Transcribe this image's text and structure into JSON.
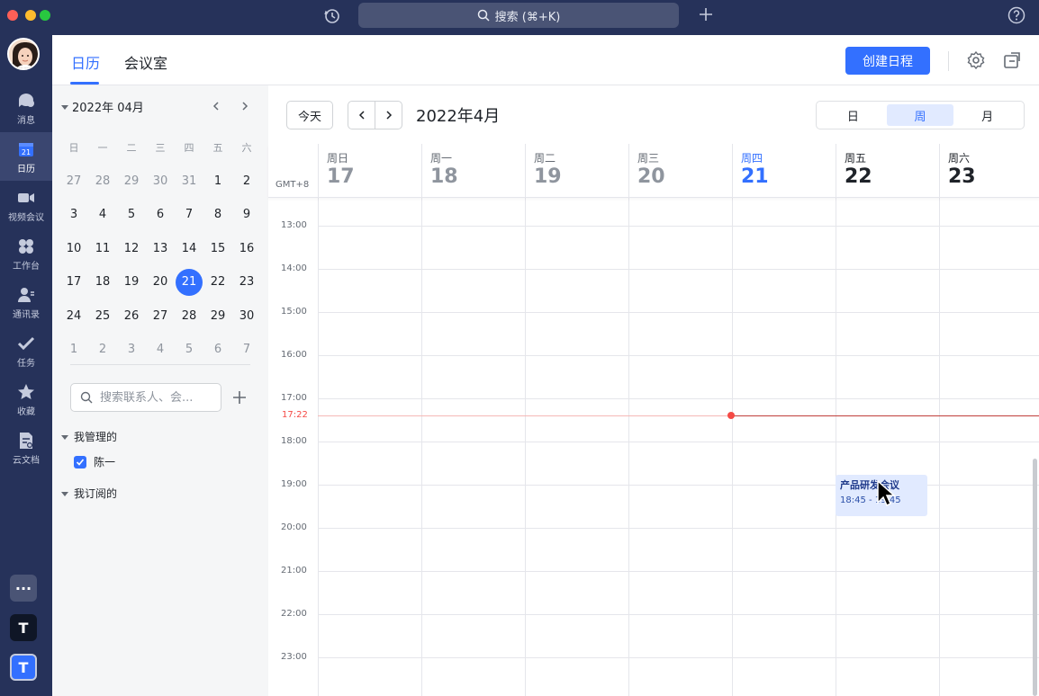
{
  "titlebar": {
    "search_label": "搜索 (⌘+K)"
  },
  "rail": {
    "items": [
      {
        "label": "消息",
        "icon": "message-icon"
      },
      {
        "label": "日历",
        "icon": "calendar-icon",
        "badge": "21"
      },
      {
        "label": "视频会议",
        "icon": "video-icon"
      },
      {
        "label": "工作台",
        "icon": "workspace-icon"
      },
      {
        "label": "通讯录",
        "icon": "contacts-icon"
      },
      {
        "label": "任务",
        "icon": "task-icon"
      },
      {
        "label": "收藏",
        "icon": "star-icon"
      },
      {
        "label": "云文档",
        "icon": "doc-icon"
      }
    ],
    "bottom": {
      "more": "···",
      "t1": "T",
      "t2": "T"
    }
  },
  "topbar": {
    "tab_calendar": "日历",
    "tab_room": "会议室",
    "create_label": "创建日程"
  },
  "mini": {
    "month_label": "2022年 04月",
    "weekdays": [
      "日",
      "一",
      "二",
      "三",
      "四",
      "五",
      "六"
    ],
    "weeks": [
      [
        "27",
        "28",
        "29",
        "30",
        "31",
        "1",
        "2"
      ],
      [
        "3",
        "4",
        "5",
        "6",
        "7",
        "8",
        "9"
      ],
      [
        "10",
        "11",
        "12",
        "13",
        "14",
        "15",
        "16"
      ],
      [
        "17",
        "18",
        "19",
        "20",
        "21",
        "22",
        "23"
      ],
      [
        "24",
        "25",
        "26",
        "27",
        "28",
        "29",
        "30"
      ],
      [
        "1",
        "2",
        "3",
        "4",
        "5",
        "6",
        "7"
      ]
    ],
    "today": "21"
  },
  "panel": {
    "search_placeholder": "搜索联系人、会...",
    "managed_label": "我管理的",
    "managed_item": "陈一",
    "subscribed_label": "我订阅的"
  },
  "toolbar": {
    "today_label": "今天",
    "month_title": "2022年4月",
    "views": [
      "日",
      "周",
      "月"
    ],
    "active_view": "周"
  },
  "week": {
    "gmt": "GMT+8",
    "days": [
      {
        "wd": "周日",
        "dn": "17"
      },
      {
        "wd": "周一",
        "dn": "18"
      },
      {
        "wd": "周二",
        "dn": "19"
      },
      {
        "wd": "周三",
        "dn": "20"
      },
      {
        "wd": "周四",
        "dn": "21"
      },
      {
        "wd": "周五",
        "dn": "22"
      },
      {
        "wd": "周六",
        "dn": "23"
      }
    ],
    "hours": [
      "13:00",
      "14:00",
      "15:00",
      "16:00",
      "17:00",
      "18:00",
      "19:00",
      "20:00",
      "21:00",
      "22:00",
      "23:00"
    ],
    "now": "17:22",
    "event": {
      "title": "产品研发会议",
      "time": "18:45 - 19:45"
    }
  },
  "colors": {
    "accent": "#3370ff",
    "rail": "#26325a",
    "now": "#f54a45"
  }
}
